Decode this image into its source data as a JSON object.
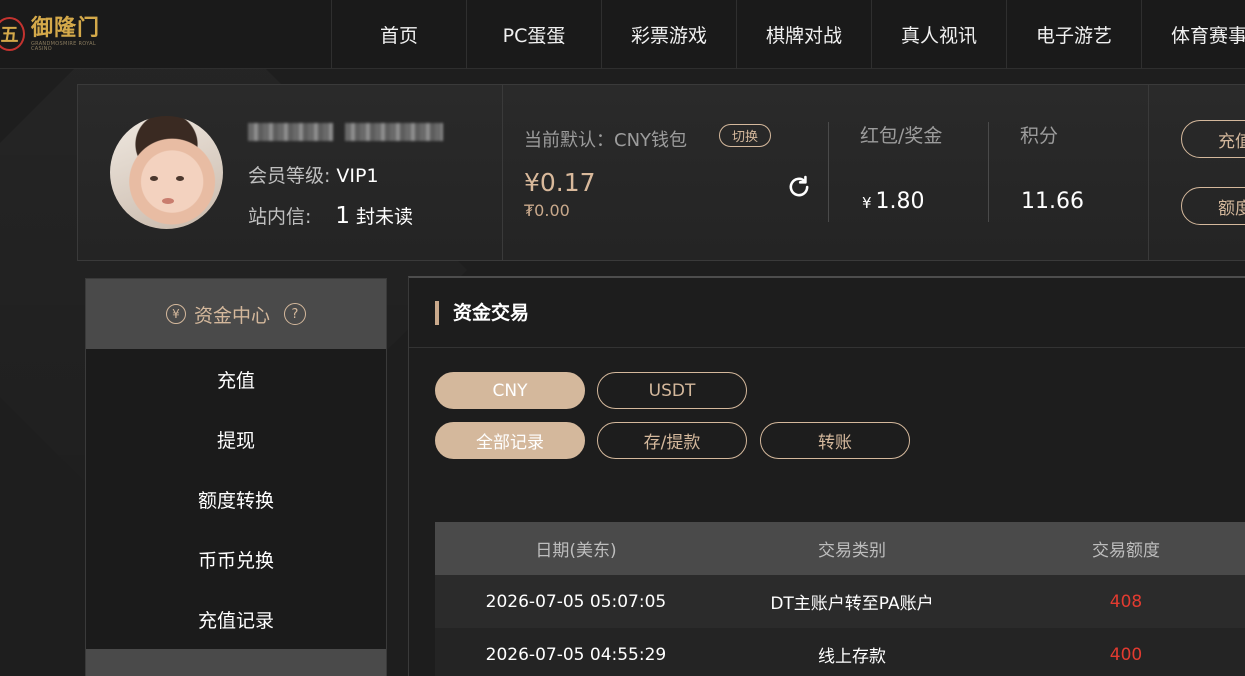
{
  "logo": {
    "mark": "五",
    "name": "御隆门",
    "tagline": "GRANDMOSMIRE ROYAL CASINO"
  },
  "nav": [
    "首页",
    "PC蛋蛋",
    "彩票游戏",
    "棋牌对战",
    "真人视讯",
    "电子游艺",
    "体育赛事"
  ],
  "user": {
    "level_label": "会员等级:",
    "level_value": "VIP1",
    "inbox_label": "站内信:",
    "inbox_count": "1",
    "inbox_suffix": "封未读"
  },
  "wallet": {
    "label": "当前默认：CNY钱包",
    "switch": "切换",
    "amount": "¥0.17",
    "sub_amount": "₮0.00"
  },
  "stats": {
    "bonus_label": "红包/奖金",
    "bonus_currency": "¥",
    "bonus_value": "1.80",
    "points_label": "积分",
    "points_value": "11.66"
  },
  "right_buttons": [
    "充值",
    "额度转换"
  ],
  "sidebar": {
    "title": "资金中心",
    "currency_icon": "¥",
    "help_icon": "?",
    "items": [
      "充值",
      "提现",
      "额度转换",
      "币币兑换",
      "充值记录"
    ]
  },
  "main": {
    "title": "资金交易",
    "currency_tabs": [
      "CNY",
      "USDT"
    ],
    "filter_tabs": [
      "全部记录",
      "存/提款",
      "转账"
    ],
    "table": {
      "headers": [
        "日期(美东)",
        "交易类别",
        "交易额度"
      ],
      "rows": [
        [
          "2026-07-05 05:07:05",
          "DT主账户转至PA账户",
          "408"
        ],
        [
          "2026-07-05 04:55:29",
          "线上存款",
          "400"
        ]
      ]
    }
  },
  "colors": {
    "accent": "#d4b89c",
    "negative": "#e23b30"
  }
}
